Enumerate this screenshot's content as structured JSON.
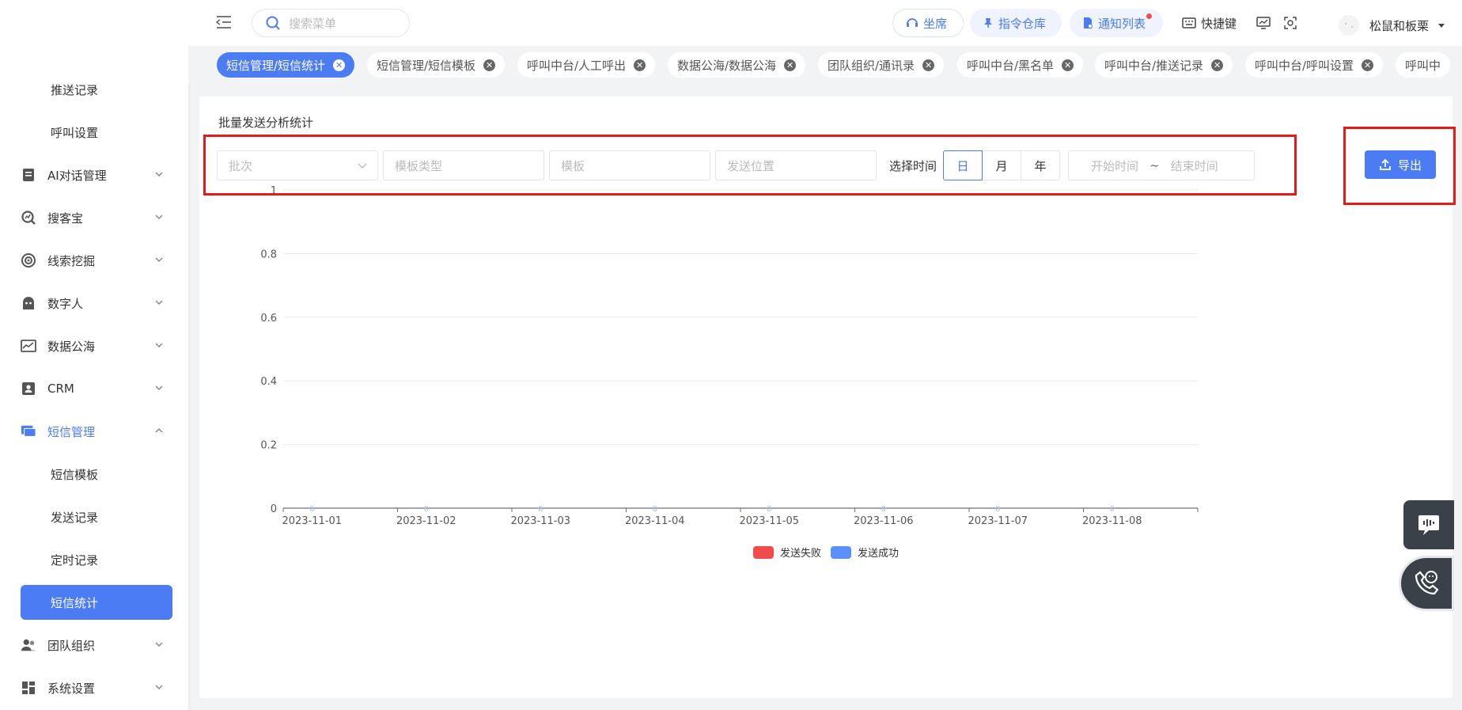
{
  "sidebar": {
    "items": [
      {
        "label": "推送记录",
        "type": "sub"
      },
      {
        "label": "呼叫设置",
        "type": "sub"
      },
      {
        "label": "AI对话管理",
        "icon": "document-icon"
      },
      {
        "label": "搜客宝",
        "icon": "magnifier-chart-icon"
      },
      {
        "label": "线索挖掘",
        "icon": "target-icon"
      },
      {
        "label": "数字人",
        "icon": "robot-icon"
      },
      {
        "label": "数据公海",
        "icon": "chart-line-icon"
      },
      {
        "label": "CRM",
        "icon": "contact-card-icon"
      },
      {
        "label": "短信管理",
        "icon": "message-icon",
        "expanded": true
      },
      {
        "label": "短信模板",
        "type": "sub"
      },
      {
        "label": "发送记录",
        "type": "sub"
      },
      {
        "label": "定时记录",
        "type": "sub"
      },
      {
        "label": "短信统计",
        "type": "sub",
        "active": true
      },
      {
        "label": "团队组织",
        "icon": "team-icon"
      },
      {
        "label": "系统设置",
        "icon": "dashboard-icon"
      }
    ]
  },
  "topbar": {
    "search_placeholder": "搜索菜单",
    "seat_label": "坐席",
    "command_label": "指令仓库",
    "notify_label": "通知列表",
    "shortcut_label": "快捷键",
    "username": "松鼠和板栗"
  },
  "tabs": [
    {
      "label": "短信管理/短信统计",
      "active": true
    },
    {
      "label": "短信管理/短信模板"
    },
    {
      "label": "呼叫中台/人工呼出"
    },
    {
      "label": "数据公海/数据公海"
    },
    {
      "label": "团队组织/通讯录"
    },
    {
      "label": "呼叫中台/黑名单"
    },
    {
      "label": "呼叫中台/推送记录"
    },
    {
      "label": "呼叫中台/呼叫设置"
    },
    {
      "label": "呼叫中"
    }
  ],
  "panel": {
    "title": "批量发送分析统计",
    "batch_placeholder": "批次",
    "template_type_placeholder": "模板类型",
    "template_placeholder": "模板",
    "send_position_placeholder": "发送位置",
    "time_label": "选择时间",
    "time_options": [
      "日",
      "月",
      "年"
    ],
    "selected_time_option": "日",
    "start_placeholder": "开始时间",
    "range_separator": "~",
    "end_placeholder": "结束时间",
    "export_label": "导出"
  },
  "colors": {
    "accent": "#4b7cf3",
    "fail": "#f04c4c",
    "success": "#5b8ff9",
    "highlight": "#e81919"
  },
  "chart_data": {
    "type": "bar",
    "categories": [
      "2023-11-01",
      "2023-11-02",
      "2023-11-03",
      "2023-11-04",
      "2023-11-05",
      "2023-11-06",
      "2023-11-07",
      "2023-11-08"
    ],
    "series": [
      {
        "name": "发送失败",
        "values": [
          0,
          0,
          0,
          0,
          0,
          0,
          0,
          0
        ],
        "color": "#f04c4c"
      },
      {
        "name": "发送成功",
        "values": [
          0,
          0,
          0,
          0,
          0,
          0,
          0,
          0
        ],
        "color": "#5b8ff9"
      }
    ],
    "yticks": [
      "0",
      "0.2",
      "0.4",
      "0.6",
      "0.8",
      "1"
    ],
    "ylim": [
      0,
      1
    ],
    "grid": true,
    "legend": "bottom-center"
  }
}
